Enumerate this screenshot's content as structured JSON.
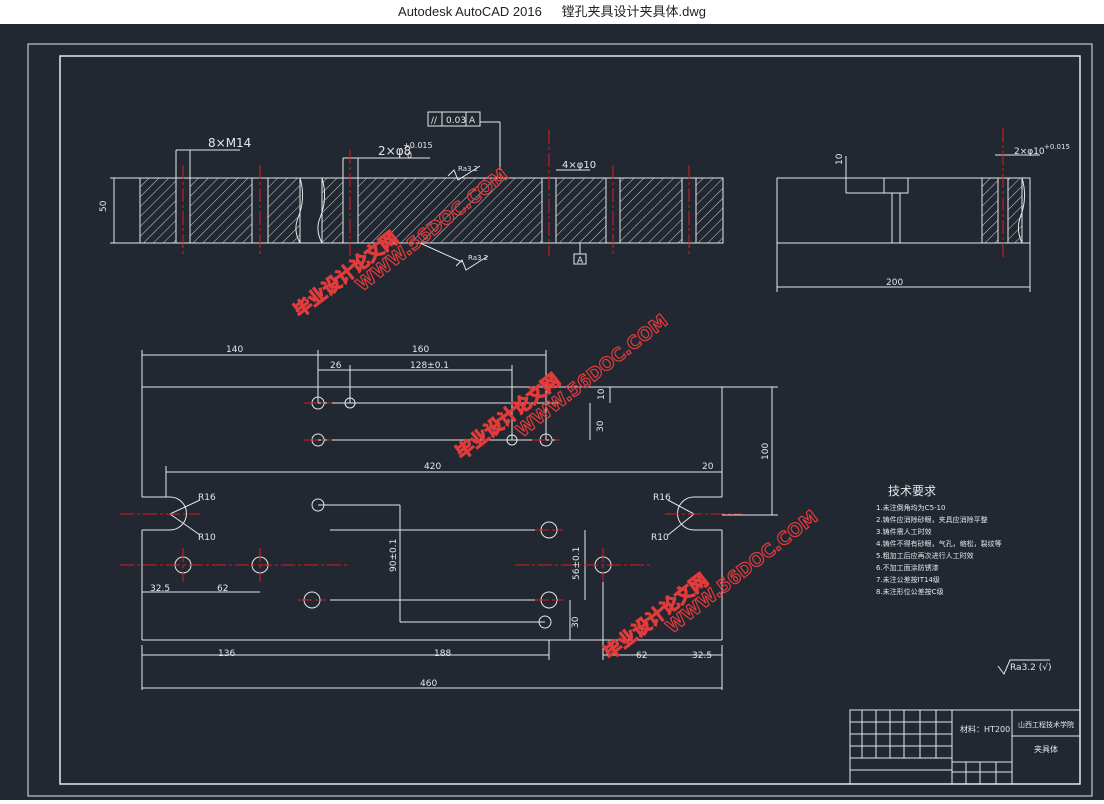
{
  "window": {
    "app_name": "Autodesk AutoCAD 2016",
    "file_name": "镗孔夹具设计夹具体.dwg"
  },
  "colors": {
    "canvas_bg": "#222832",
    "line": "#e6e6e6",
    "center_line": "#e01818",
    "watermark": "#e23b3b"
  },
  "top_view": {
    "thread_callout": "8×M14",
    "hole_callout": "2×φ8",
    "hole_tol_upper": "+0.015",
    "hole_tol_lower": "0",
    "hole_depth_callout": "4×φ10",
    "height_dim": "50",
    "gdt_symbol": "//",
    "gdt_value": "0.03",
    "gdt_datum": "A",
    "datum_label": "A",
    "rough_top": "Ra3.2",
    "rough_bottom": "Ra3.2"
  },
  "side_view": {
    "depth_dim": "10",
    "hole_callout": "2×φ10",
    "hole_tol": "+0.015",
    "width_dim": "200"
  },
  "plan_view": {
    "dim_140": "140",
    "dim_160": "160",
    "dim_26": "26",
    "dim_128": "128±0.1",
    "dim_10": "10",
    "dim_30_upper": "30",
    "dim_100": "100",
    "dim_420": "420",
    "dim_20": "20",
    "r16_left": "R16",
    "r10_left": "R10",
    "r16_right": "R16",
    "r10_right": "R10",
    "dim_90": "90±0.1",
    "dim_56": "56±0.1",
    "dim_32_5": "32.5",
    "dim_62_left": "62",
    "dim_30_lower": "30",
    "dim_136": "136",
    "dim_188": "188",
    "dim_62_right": "62",
    "dim_32_5_right": "32.5",
    "dim_460": "460"
  },
  "tech_requirements": {
    "title": "技术要求",
    "items": [
      "1.未注倒角均为C5-10",
      "2.铸件应消除砂眼，夹具应消除平整",
      "3.铸件需人工时效",
      "4.铸件不得有砂眼，气孔，缩松，裂纹等",
      "5.粗加工后应再次进行人工时效",
      "6.不加工面涂防锈漆",
      "7.未注公差按IT14级",
      "8.未注形位公差按C级"
    ]
  },
  "roughness_note": "Ra3.2 (√)",
  "title_block": {
    "material": "材料：HT200",
    "school": "山西工程技术学院",
    "part_name": "夹具体"
  },
  "watermarks": {
    "site": "毕业设计论文网",
    "url": "WWW.56DOC.COM"
  }
}
